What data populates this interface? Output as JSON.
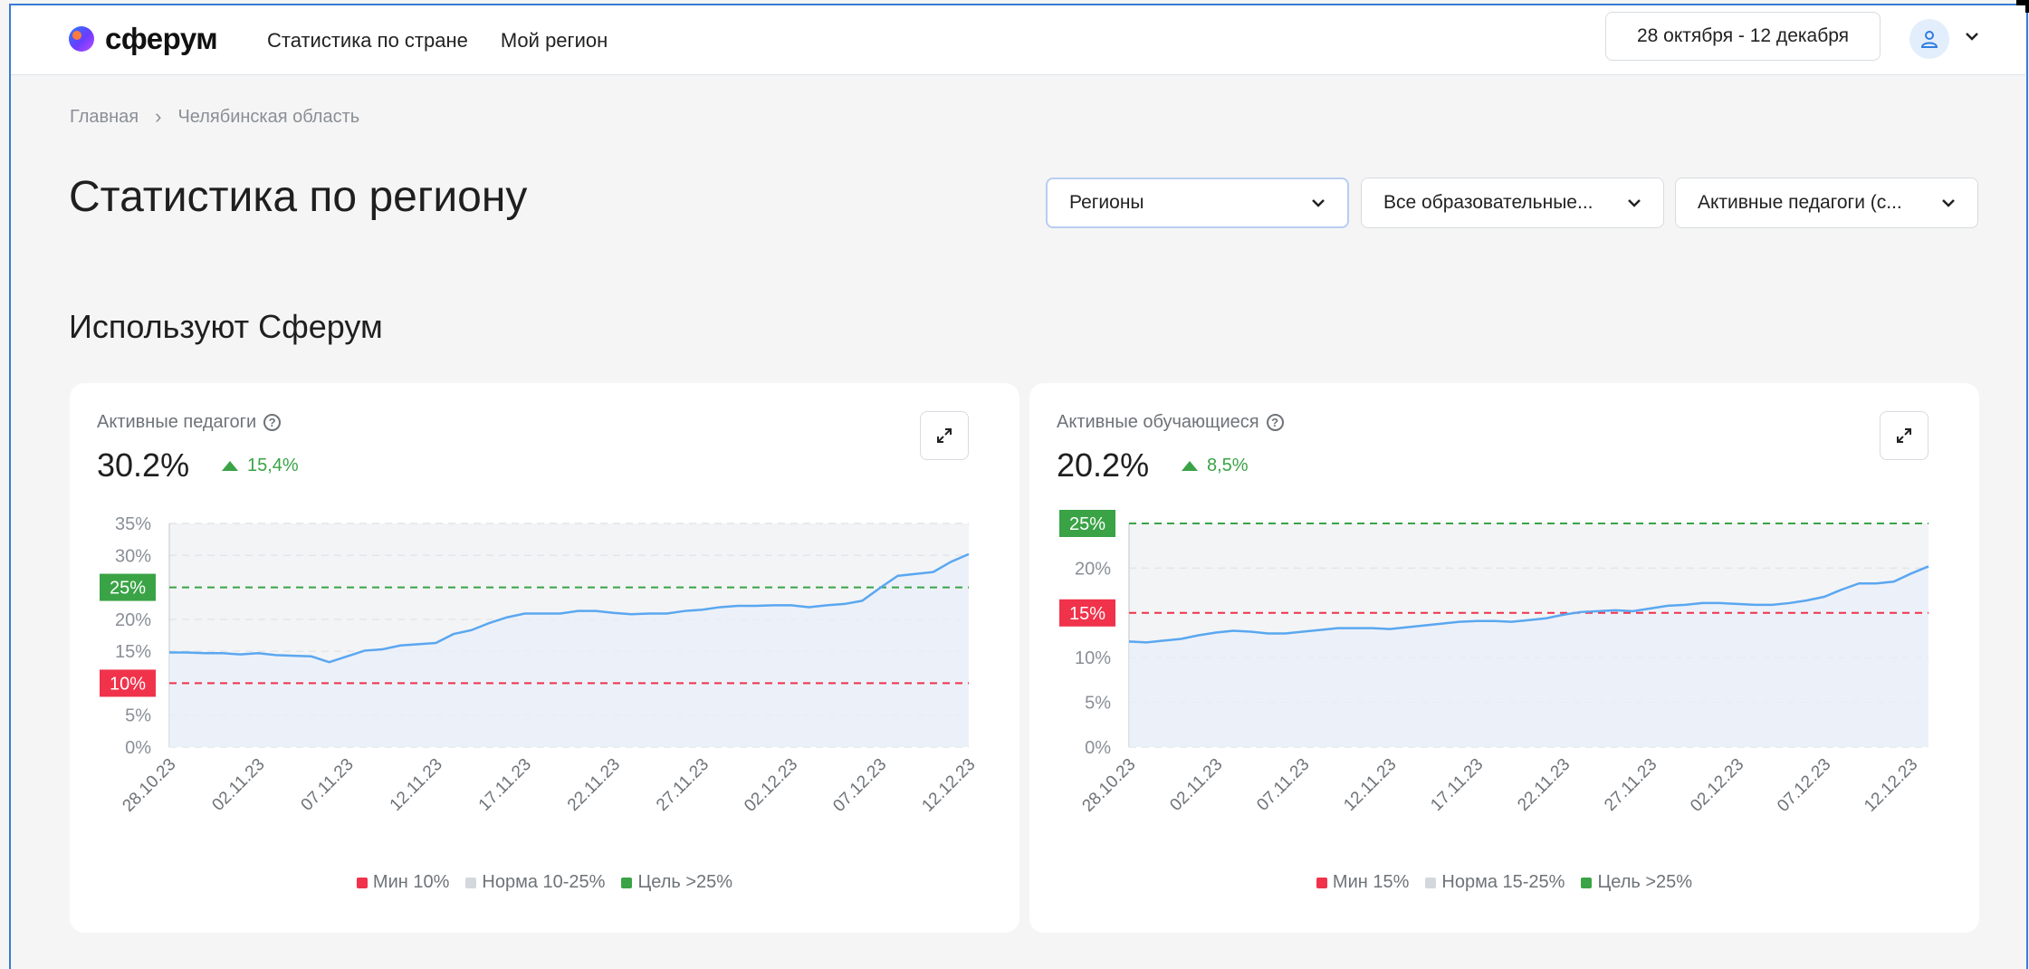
{
  "header": {
    "logo_text": "сферум",
    "nav": [
      "Статистика по стране",
      "Мой регион"
    ],
    "date_range": "28 октября - 12 декабря"
  },
  "breadcrumb": {
    "home": "Главная",
    "current": "Челябинская область"
  },
  "page_title": "Статистика по региону",
  "filters": [
    {
      "label": "Регионы"
    },
    {
      "label": "Все образовательные..."
    },
    {
      "label": "Активные педагоги (с..."
    }
  ],
  "section_title": "Используют Сферум",
  "colors": {
    "accent": "#2f7de1",
    "green": "#3aa346",
    "red": "#f0324b",
    "line": "#5aa7f0"
  },
  "chart_data": [
    {
      "type": "line",
      "title": "Активные педагоги",
      "value": "30.2%",
      "delta": "15,4%",
      "x": [
        "28.10.23",
        "29.10.23",
        "30.10.23",
        "31.10.23",
        "01.11.23",
        "02.11.23",
        "03.11.23",
        "04.11.23",
        "05.11.23",
        "06.11.23",
        "07.11.23",
        "08.11.23",
        "09.11.23",
        "10.11.23",
        "11.11.23",
        "12.11.23",
        "13.11.23",
        "14.11.23",
        "15.11.23",
        "16.11.23",
        "17.11.23",
        "18.11.23",
        "19.11.23",
        "20.11.23",
        "21.11.23",
        "22.11.23",
        "23.11.23",
        "24.11.23",
        "25.11.23",
        "26.11.23",
        "27.11.23",
        "28.11.23",
        "29.11.23",
        "30.11.23",
        "01.12.23",
        "02.12.23",
        "03.12.23",
        "04.12.23",
        "05.12.23",
        "06.12.23",
        "07.12.23",
        "08.12.23",
        "09.12.23",
        "10.12.23",
        "11.12.23",
        "12.12.23"
      ],
      "x_ticks": [
        "28.10.23",
        "02.11.23",
        "07.11.23",
        "12.11.23",
        "17.11.23",
        "22.11.23",
        "27.11.23",
        "02.12.23",
        "07.12.23",
        "12.12.23"
      ],
      "values": [
        14.8,
        14.8,
        14.7,
        14.7,
        14.5,
        14.7,
        14.4,
        14.3,
        14.2,
        13.3,
        14.2,
        15.1,
        15.3,
        15.9,
        16.1,
        16.3,
        17.7,
        18.3,
        19.4,
        20.3,
        20.9,
        20.9,
        20.9,
        21.3,
        21.3,
        21.0,
        20.8,
        20.9,
        20.9,
        21.3,
        21.5,
        21.9,
        22.1,
        22.1,
        22.2,
        22.2,
        21.9,
        22.2,
        22.4,
        22.9,
        24.9,
        26.8,
        27.1,
        27.4,
        29.0,
        30.2
      ],
      "ylim": [
        0,
        35
      ],
      "y_ticks": [
        "0%",
        "5%",
        "10%",
        "15%",
        "20%",
        "25%",
        "30%",
        "35%"
      ],
      "min_line": 10,
      "goal_line": 25,
      "min_label": "10%",
      "goal_label": "25%",
      "grid": true,
      "legend": [
        "Мин 10%",
        "Норма 10-25%",
        "Цель >25%"
      ]
    },
    {
      "type": "line",
      "title": "Активные обучающиеся",
      "value": "20.2%",
      "delta": "8,5%",
      "x": [
        "28.10.23",
        "29.10.23",
        "30.10.23",
        "31.10.23",
        "01.11.23",
        "02.11.23",
        "03.11.23",
        "04.11.23",
        "05.11.23",
        "06.11.23",
        "07.11.23",
        "08.11.23",
        "09.11.23",
        "10.11.23",
        "11.11.23",
        "12.11.23",
        "13.11.23",
        "14.11.23",
        "15.11.23",
        "16.11.23",
        "17.11.23",
        "18.11.23",
        "19.11.23",
        "20.11.23",
        "21.11.23",
        "22.11.23",
        "23.11.23",
        "24.11.23",
        "25.11.23",
        "26.11.23",
        "27.11.23",
        "28.11.23",
        "29.11.23",
        "30.11.23",
        "01.12.23",
        "02.12.23",
        "03.12.23",
        "04.12.23",
        "05.12.23",
        "06.12.23",
        "07.12.23",
        "08.12.23",
        "09.12.23",
        "10.12.23",
        "11.12.23",
        "12.12.23"
      ],
      "x_ticks": [
        "28.10.23",
        "02.11.23",
        "07.11.23",
        "12.11.23",
        "17.11.23",
        "22.11.23",
        "27.11.23",
        "02.12.23",
        "07.12.23",
        "12.12.23"
      ],
      "values": [
        11.8,
        11.7,
        11.9,
        12.1,
        12.5,
        12.8,
        13.0,
        12.9,
        12.7,
        12.7,
        12.9,
        13.1,
        13.3,
        13.3,
        13.3,
        13.2,
        13.4,
        13.6,
        13.8,
        14.0,
        14.1,
        14.1,
        14.0,
        14.2,
        14.4,
        14.8,
        15.1,
        15.2,
        15.3,
        15.2,
        15.5,
        15.8,
        15.9,
        16.1,
        16.1,
        16.0,
        15.9,
        15.9,
        16.1,
        16.4,
        16.8,
        17.6,
        18.3,
        18.3,
        18.5,
        19.4,
        20.2
      ],
      "ylim": [
        0,
        25
      ],
      "y_ticks": [
        "0%",
        "5%",
        "10%",
        "15%",
        "20%",
        "25%"
      ],
      "min_line": 15,
      "goal_line": 25,
      "min_label": "15%",
      "goal_label": "25%",
      "grid": true,
      "legend": [
        "Мин 15%",
        "Норма 15-25%",
        "Цель >25%"
      ]
    }
  ]
}
